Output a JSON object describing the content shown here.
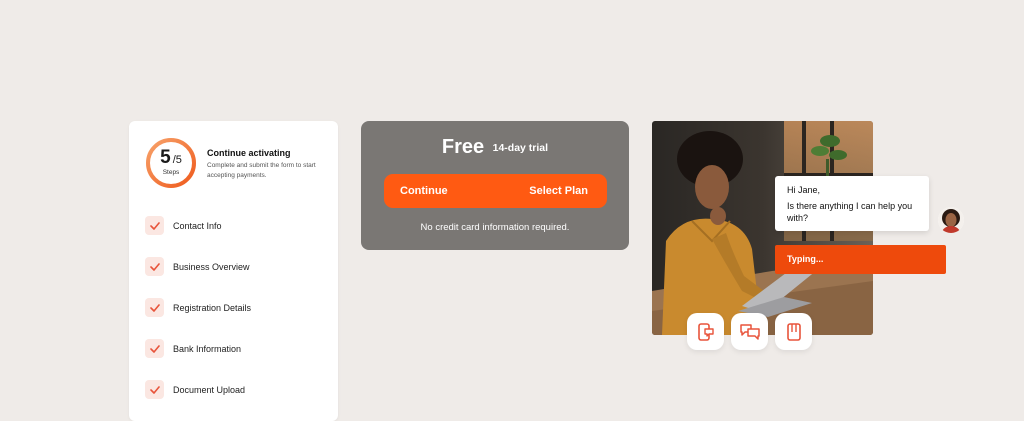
{
  "activation": {
    "current_step": "5",
    "total_steps": "/5",
    "steps_label": "Steps",
    "progress_fraction": 1.0,
    "title": "Continue activating",
    "description": "Complete and submit the form to start accepting payments."
  },
  "steps": [
    {
      "label": "Contact Info",
      "done": true
    },
    {
      "label": "Business Overview",
      "done": true
    },
    {
      "label": "Registration Details",
      "done": true
    },
    {
      "label": "Bank Information",
      "done": true
    },
    {
      "label": "Document Upload",
      "done": true
    }
  ],
  "plan": {
    "name": "Free",
    "trial": "14-day trial",
    "continue_label": "Continue",
    "select_label": "Select Plan",
    "note": "No credit card information required."
  },
  "chat": {
    "greeting": "Hi Jane,",
    "message": "Is there anything I can help you with?",
    "typing": "Typing..."
  },
  "channels": [
    "mobile-chat-icon",
    "chat-bubbles-icon",
    "document-icon"
  ],
  "colors": {
    "accent": "#ff5a12",
    "accent_dark": "#ee4a0c",
    "check_bg": "#fbe7e2",
    "check": "#e8543b",
    "plan_card": "#7a7774",
    "background": "#efebe8"
  }
}
